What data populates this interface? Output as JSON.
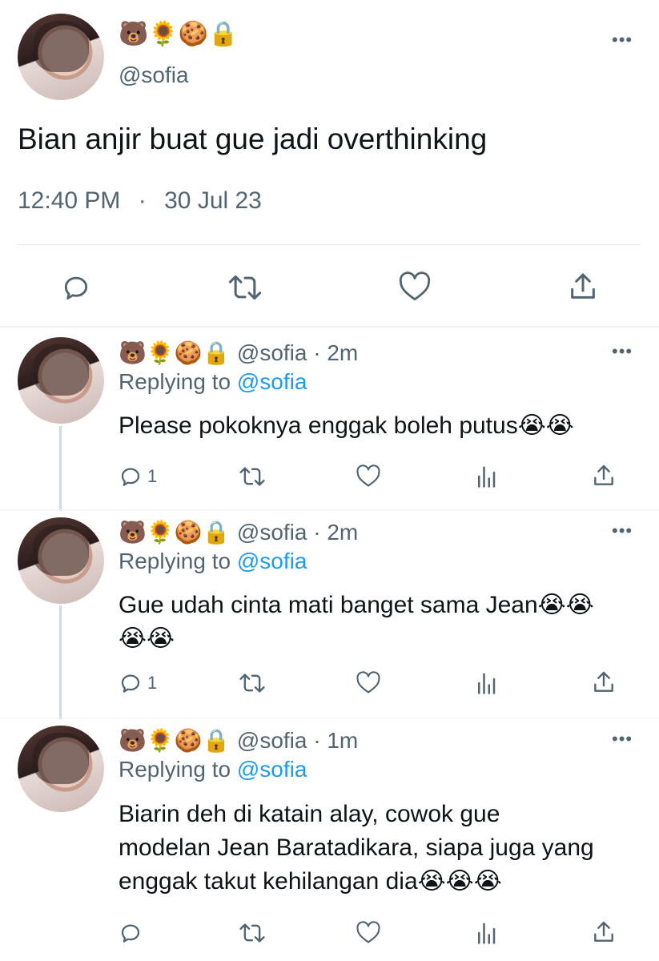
{
  "main_tweet": {
    "display_name": "🐻🌻🍪🔒",
    "handle": "@sofia",
    "text": "Bian anjir buat gue jadi overthinking",
    "time": "12:40 PM",
    "separator": "·",
    "date": "30 Jul 23"
  },
  "replies": [
    {
      "display_name": "🐻🌻🍪🔒",
      "handle_time": "@sofia · 2m",
      "replying_label": "Replying to ",
      "replying_handle": "@sofia",
      "text": "Please pokoknya enggak boleh putus😭😭",
      "reply_count": "1"
    },
    {
      "display_name": "🐻🌻🍪🔒",
      "handle_time": "@sofia · 2m",
      "replying_label": "Replying to ",
      "replying_handle": "@sofia",
      "text_line1": "Gue udah cinta mati banget sama Jean😭😭",
      "text_line2": "😭😭",
      "reply_count": "1"
    },
    {
      "display_name": "🐻🌻🍪🔒",
      "handle_time": "@sofia · 1m",
      "replying_label": "Replying to ",
      "replying_handle": "@sofia",
      "text_line1": "Biarin deh di katain alay, cowok gue",
      "text_line2": "modelan Jean Baratadikara, siapa juga yang",
      "text_line3": "enggak takut kehilangan dia😭😭😭",
      "reply_count": ""
    }
  ],
  "icons": {
    "more": "more-icon",
    "reply": "reply-icon",
    "retweet": "retweet-icon",
    "like": "like-icon",
    "views": "views-icon",
    "share": "share-icon"
  },
  "colors": {
    "text": "#0f1419",
    "secondary": "#536471",
    "link": "#1d9bf0",
    "divider": "#e2e6ea"
  }
}
